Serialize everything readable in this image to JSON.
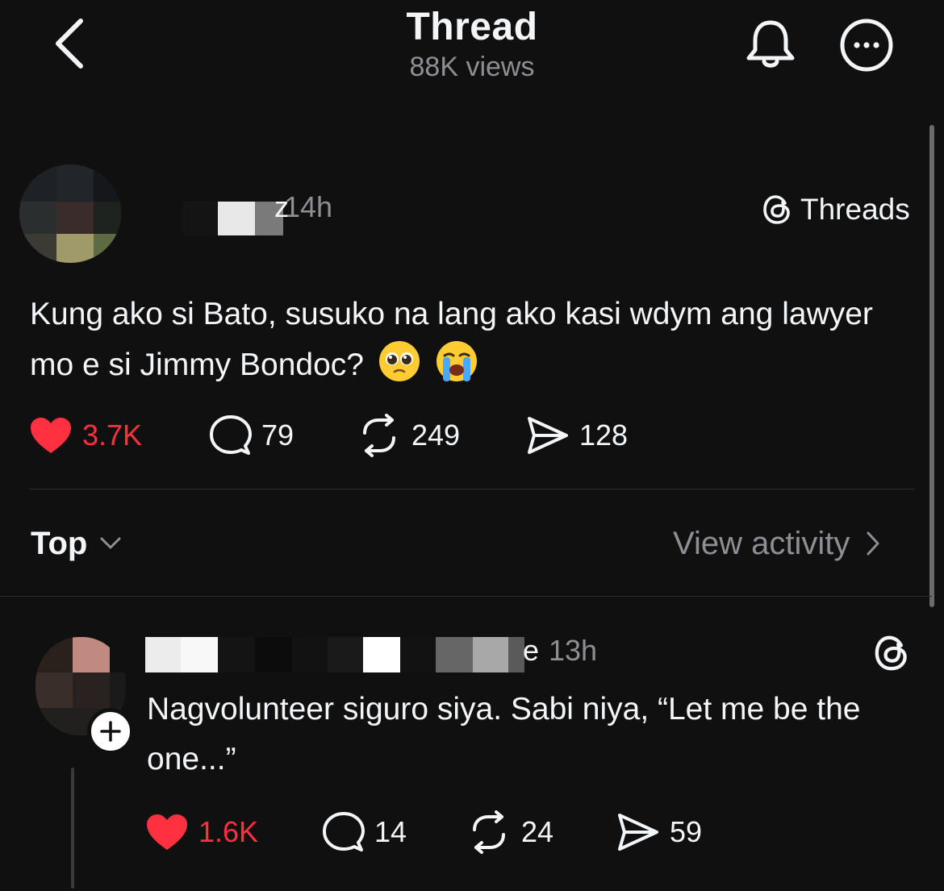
{
  "header": {
    "title": "Thread",
    "views": "88K views"
  },
  "post": {
    "username_visible_suffix": "z",
    "time": "14h",
    "source_badge": "Threads",
    "text": "Kung ako si Bato, susuko na lang ako kasi wdym ang lawyer mo e si Jimmy Bondoc?",
    "emojis": [
      "pleading-face",
      "loudly-crying-face"
    ],
    "likes": "3.7K",
    "replies": "79",
    "reposts": "249",
    "shares": "128",
    "liked": true
  },
  "sort": {
    "label": "Top",
    "view_activity": "View activity"
  },
  "reply": {
    "username_visible_suffix": "e",
    "time": "13h",
    "text": "Nagvolunteer siguro siya. Sabi niya, “Let me be the one...”",
    "likes": "1.6K",
    "replies": "14",
    "reposts": "24",
    "shares": "59",
    "liked": true
  },
  "colors": {
    "background": "#101010",
    "text": "#f3f5f7",
    "secondary": "#8e8e93",
    "like": "#ff3040"
  }
}
